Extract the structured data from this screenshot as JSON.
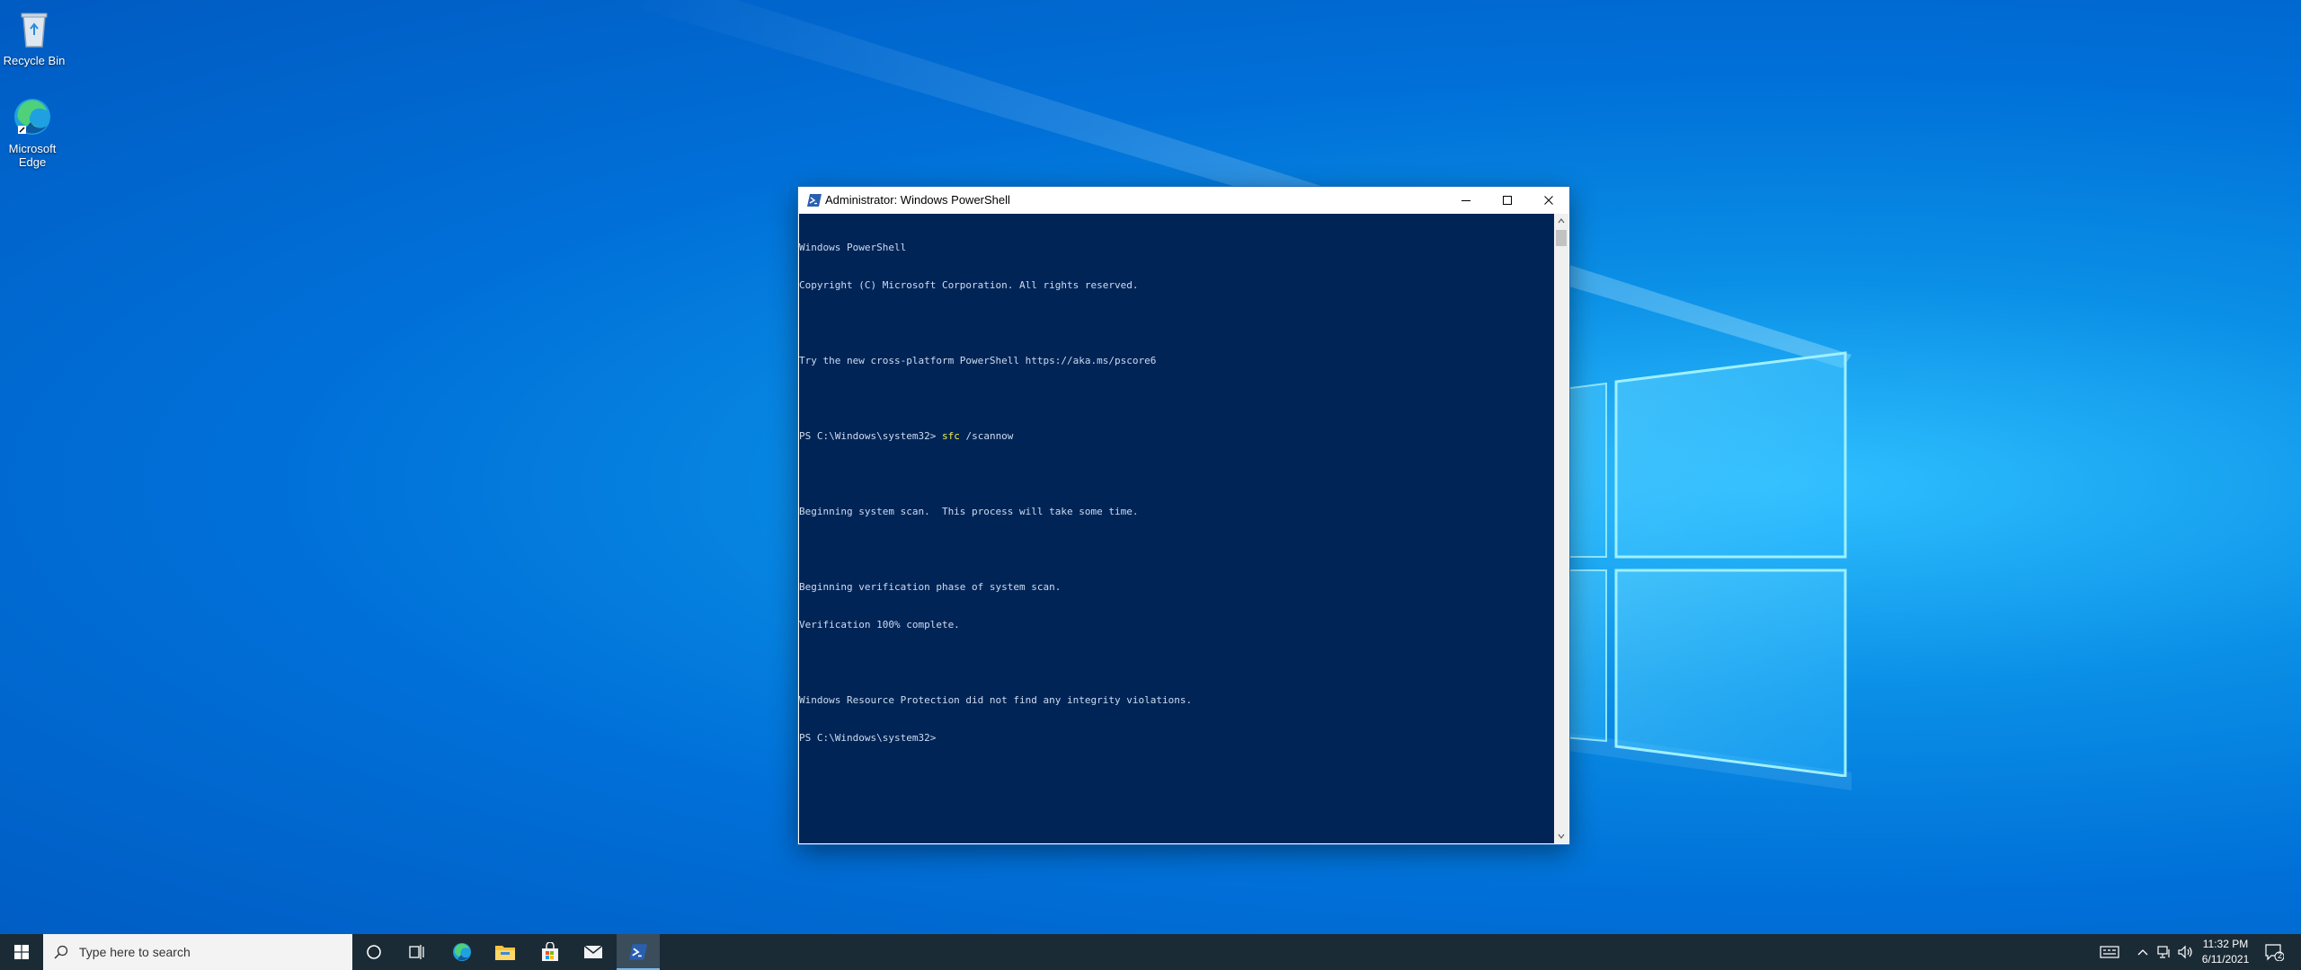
{
  "desktop": {
    "icons": [
      {
        "label": "Recycle Bin",
        "icon": "recycle-bin-icon"
      },
      {
        "label": "Microsoft Edge",
        "icon": "edge-icon"
      }
    ]
  },
  "window": {
    "title": "Administrator: Windows PowerShell",
    "controls": {
      "minimize": "minimize-icon",
      "maximize": "maximize-icon",
      "close": "close-icon"
    },
    "console": {
      "lines": [
        "Windows PowerShell",
        "Copyright (C) Microsoft Corporation. All rights reserved.",
        "",
        "Try the new cross-platform PowerShell https://aka.ms/pscore6",
        "",
        "",
        "",
        "Beginning system scan.  This process will take some time.",
        "",
        "Beginning verification phase of system scan.",
        "Verification 100% complete.",
        "",
        "Windows Resource Protection did not find any integrity violations.",
        "PS C:\\Windows\\system32>"
      ],
      "command_line": {
        "prompt": "PS C:\\Windows\\system32> ",
        "command": "sfc",
        "args": " /scannow"
      },
      "background": "#012456",
      "foreground": "#ccdcf0",
      "command_color": "#f0f050"
    }
  },
  "taskbar": {
    "search_placeholder": "Type here to search",
    "apps": [
      {
        "name": "cortana",
        "icon": "cortana-icon"
      },
      {
        "name": "task-view",
        "icon": "task-view-icon"
      },
      {
        "name": "edge",
        "icon": "edge-icon"
      },
      {
        "name": "file-explorer",
        "icon": "folder-icon"
      },
      {
        "name": "store",
        "icon": "store-icon"
      },
      {
        "name": "mail",
        "icon": "mail-icon"
      },
      {
        "name": "powershell",
        "icon": "powershell-icon",
        "active": true
      }
    ],
    "clock": {
      "time": "11:32 PM",
      "date": "6/11/2021"
    },
    "notification_count": "2"
  }
}
